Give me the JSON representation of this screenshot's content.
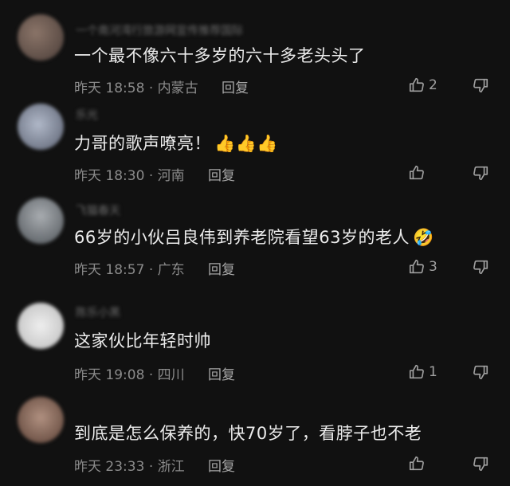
{
  "colors": {
    "background": "#111111",
    "text": "#ececec",
    "meta": "#8b8b8b"
  },
  "comments": [
    {
      "username": "一个南河湾行旅游网宣传推荐国际",
      "text": "一个最不像六十多岁的六十多老头头了",
      "emoji": "",
      "time": "昨天 18:58",
      "location": "内蒙古",
      "reply_label": "回复",
      "likes": "2",
      "avatar_color": "#6b5a52"
    },
    {
      "username": "乐光",
      "text": "力哥的歌声嘹亮！",
      "emoji": "👍👍👍",
      "time": "昨天 18:30",
      "location": "河南",
      "reply_label": "回复",
      "likes": "",
      "avatar_color": "#7a8496"
    },
    {
      "username": "飞猫春天",
      "text": "66岁的小伙吕良伟到养老院看望63岁的老人",
      "emoji": "🤣",
      "time": "昨天 18:57",
      "location": "广东",
      "reply_label": "回复",
      "likes": "3",
      "avatar_color": "#8a8f95"
    },
    {
      "username": "陈乐小黑",
      "text": "这家伙比年轻时帅",
      "emoji": "",
      "time": "昨天 19:08",
      "location": "四川",
      "reply_label": "回复",
      "likes": "1",
      "avatar_color": "#d4d4d4"
    },
    {
      "username": "",
      "text": "到底是怎么保养的，快70岁了，看脖子也不老",
      "emoji": "",
      "time": "昨天 23:33",
      "location": "浙江",
      "reply_label": "回复",
      "likes": "",
      "avatar_color": "#8a6a55"
    }
  ]
}
